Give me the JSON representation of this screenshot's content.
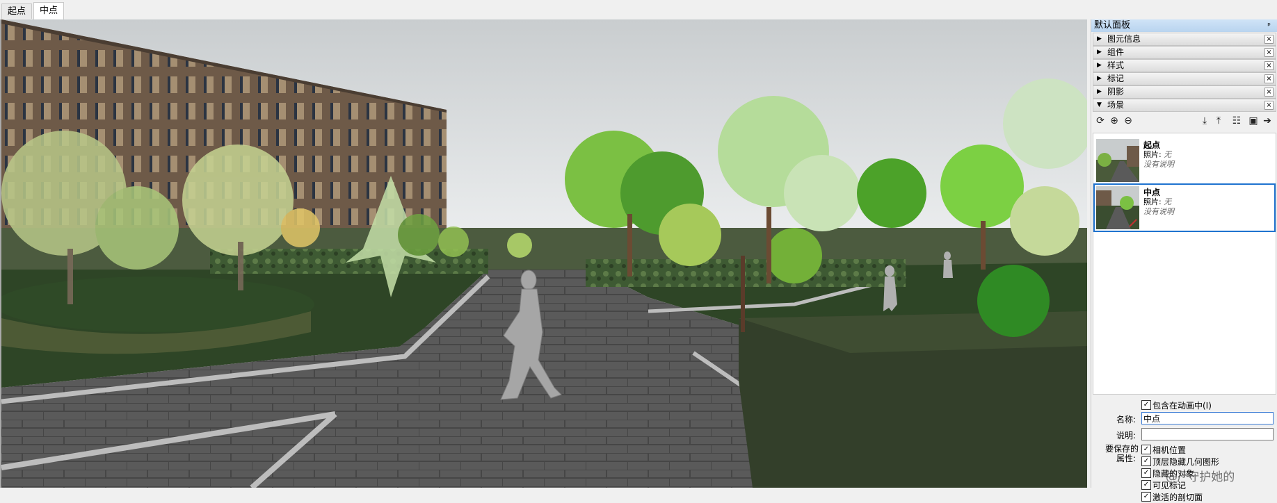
{
  "tabs": [
    {
      "label": "起点",
      "active": false
    },
    {
      "label": "中点",
      "active": true
    }
  ],
  "tray": {
    "title": "默认面板",
    "pin_glyph": "ᵖ",
    "sections": [
      {
        "label": "图元信息",
        "expanded": false
      },
      {
        "label": "组件",
        "expanded": false
      },
      {
        "label": "样式",
        "expanded": false
      },
      {
        "label": "标记",
        "expanded": false
      },
      {
        "label": "阴影",
        "expanded": false
      },
      {
        "label": "场景",
        "expanded": true
      }
    ],
    "close_glyph": "×",
    "expanded_glyph": "▼",
    "collapsed_glyph": "▶"
  },
  "scenes_toolbar": [
    {
      "name": "refresh-scene-icon",
      "glyph": "⟳"
    },
    {
      "name": "add-scene-icon",
      "glyph": "⊕"
    },
    {
      "name": "remove-scene-icon",
      "glyph": "⊖"
    },
    {
      "name": "move-scene-down-icon",
      "glyph": "⤓"
    },
    {
      "name": "move-scene-up-icon",
      "glyph": "⤒"
    },
    {
      "name": "view-options-icon",
      "glyph": "☷"
    },
    {
      "name": "show-details-icon",
      "glyph": "▣"
    },
    {
      "name": "scene-menu-icon",
      "glyph": "➔"
    }
  ],
  "scenes": [
    {
      "name": "起点",
      "photo_label": "照片:",
      "photo_value": "无",
      "description": "没有说明",
      "selected": false
    },
    {
      "name": "中点",
      "photo_label": "照片:",
      "photo_value": "无",
      "description": "没有说明",
      "selected": true
    }
  ],
  "scene_props": {
    "include_in_animation": "包含在动画中(I)",
    "name_label": "名称:",
    "name_value": "中点",
    "desc_label": "说明:",
    "desc_value": "",
    "save_props_label_1": "要保存的",
    "save_props_label_2": "属性:",
    "properties": [
      "相机位置",
      "顶层隐藏几何图形",
      "隐藏的对象",
      "可见标记",
      "激活的剖切面"
    ],
    "check_glyph": "✓"
  },
  "watermark": "@/*守护她的",
  "colors": {
    "selection_blue": "#1f73cf",
    "sky": "#d6dadb",
    "grass": "#2e4526",
    "pavement": "#575757",
    "building": "#6e5a48"
  }
}
